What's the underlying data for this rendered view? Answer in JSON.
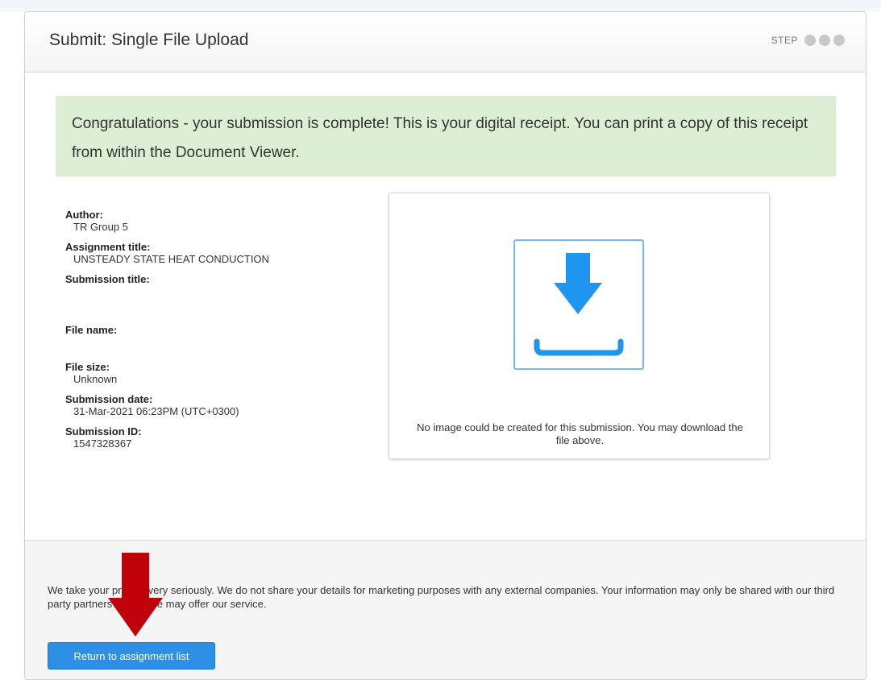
{
  "header": {
    "title": "Submit: Single File Upload",
    "step_label": "STEP",
    "step_dot_color": "#c8c8c8"
  },
  "alert": {
    "message": "Congratulations - your submission is complete! This is your digital receipt. You can print a copy of this receipt from within the Document Viewer.",
    "background": "#dcefd5"
  },
  "receipt": {
    "author_label": "Author:",
    "author_value": "TR Group 5",
    "assignment_label": "Assignment title:",
    "assignment_value": "UNSTEADY STATE HEAT CONDUCTION",
    "submission_title_label": "Submission title:",
    "submission_title_value": "",
    "file_name_label": "File name:",
    "file_name_value": "",
    "file_size_label": "File size:",
    "file_size_value": "Unknown",
    "submission_date_label": "Submission date:",
    "submission_date_value": "31-Mar-2021 06:23PM (UTC+0300)",
    "submission_id_label": "Submission ID:",
    "submission_id_value": "1547328367"
  },
  "preview": {
    "icon": "download-icon",
    "icon_color": "#1e96f0",
    "message": "No image could be created for this submission. You may download the file above."
  },
  "footer": {
    "privacy": "We take your privacy very seriously. We do not share your details for marketing purposes with any external companies. Your information may only be shared with our third party partners so that we may offer our service.",
    "return_button": "Return to assignment list",
    "button_color": "#2d8fe6"
  },
  "annotation": {
    "icon": "red-arrow-down-icon",
    "color": "#c0000b"
  }
}
